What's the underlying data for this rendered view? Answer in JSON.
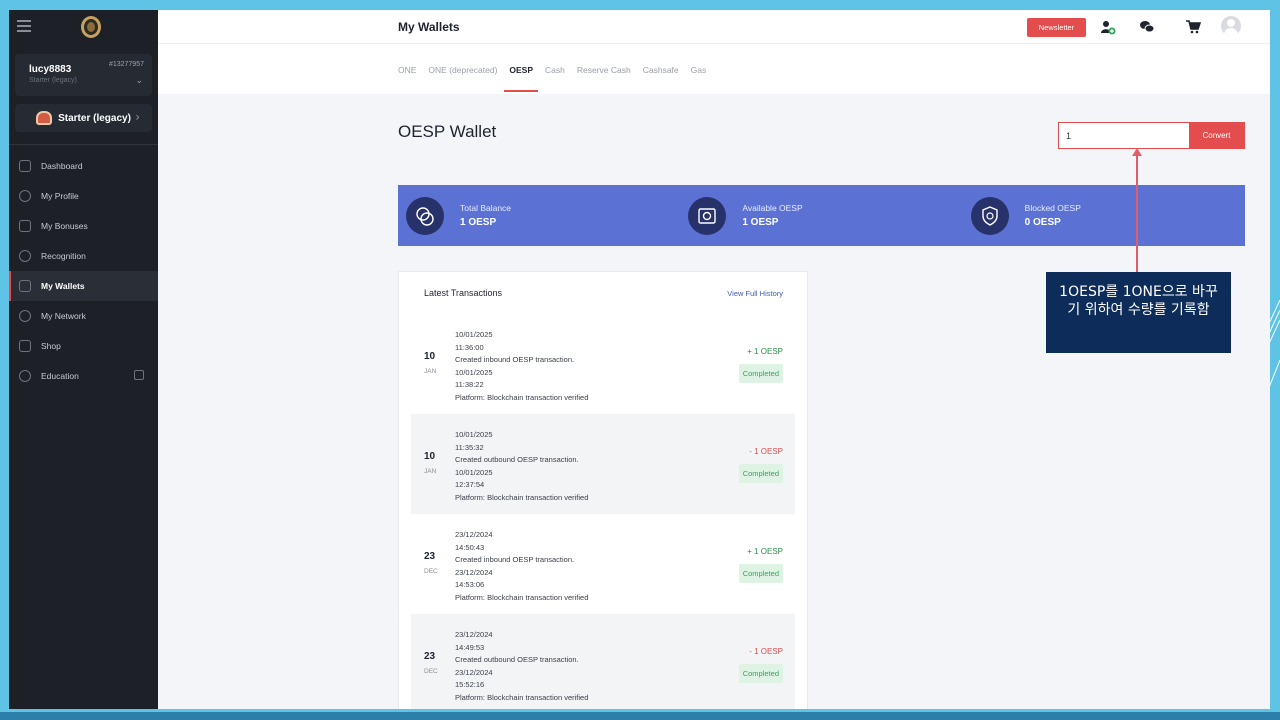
{
  "app": {
    "page_title": "My Wallets",
    "newsletter_label": "Newsletter"
  },
  "user": {
    "name": "lucy8883",
    "rank": "Starter (legacy)",
    "id": "#13277957"
  },
  "plan": {
    "label": "Starter (legacy)"
  },
  "sidebar": {
    "items": [
      {
        "label": "Dashboard",
        "icon": "home-icon"
      },
      {
        "label": "My Profile",
        "icon": "user-icon"
      },
      {
        "label": "My Bonuses",
        "icon": "gift-icon"
      },
      {
        "label": "Recognition",
        "icon": "star-badge-icon"
      },
      {
        "label": "My Wallets",
        "icon": "wallet-icon",
        "active": true
      },
      {
        "label": "My Network",
        "icon": "network-icon"
      },
      {
        "label": "Shop",
        "icon": "cart-icon"
      },
      {
        "label": "Education",
        "icon": "education-icon"
      }
    ]
  },
  "tabs": [
    {
      "label": "ONE"
    },
    {
      "label": "ONE (deprecated)"
    },
    {
      "label": "OESP",
      "active": true
    },
    {
      "label": "Cash"
    },
    {
      "label": "Reserve Cash"
    },
    {
      "label": "Cashsafe"
    },
    {
      "label": "Gas"
    }
  ],
  "wallet": {
    "title": "OESP Wallet",
    "convert_value": "1",
    "convert_label": "Convert"
  },
  "balances": [
    {
      "label": "Total Balance",
      "value": "1 OESP",
      "icon": "coins-icon"
    },
    {
      "label": "Available OESP",
      "value": "1 OESP",
      "icon": "safe-icon"
    },
    {
      "label": "Blocked OESP",
      "value": "0 OESP",
      "icon": "shield-coin-icon"
    }
  ],
  "transactions": {
    "title": "Latest Transactions",
    "view_all": "View Full History",
    "rows": [
      {
        "day": "10",
        "month": "JAN",
        "lines": [
          "10/01/2025",
          "11:36:00",
          "Created inbound OESP transaction.",
          "10/01/2025",
          "11:38:22",
          "Platform: Blockchain transaction verified"
        ],
        "amount": "+ 1 OESP",
        "status": "Completed",
        "direction": "in"
      },
      {
        "day": "10",
        "month": "JAN",
        "lines": [
          "10/01/2025",
          "11:35:32",
          "Created outbound OESP transaction.",
          "10/01/2025",
          "12:37:54",
          "Platform: Blockchain transaction verified"
        ],
        "amount": "- 1 OESP",
        "status": "Completed",
        "direction": "out"
      },
      {
        "day": "23",
        "month": "DEC",
        "lines": [
          "23/12/2024",
          "14:50:43",
          "Created inbound OESP transaction.",
          "23/12/2024",
          "14:53:06",
          "Platform: Blockchain transaction verified"
        ],
        "amount": "+ 1 OESP",
        "status": "Completed",
        "direction": "in"
      },
      {
        "day": "23",
        "month": "DEC",
        "lines": [
          "23/12/2024",
          "14:49:53",
          "Created outbound OESP transaction.",
          "23/12/2024",
          "15:52:16",
          "Platform: Blockchain transaction verified"
        ],
        "amount": "- 1 OESP",
        "status": "Completed",
        "direction": "out"
      }
    ]
  },
  "annotation": {
    "text": "1OESP를 1ONE으로 바꾸기 위하여 수량를 기록함"
  },
  "colors": {
    "accent": "#e34d4d",
    "balance_bar": "#5b72d4",
    "sidebar": "#1d2027",
    "callout": "#0e2c5a"
  }
}
